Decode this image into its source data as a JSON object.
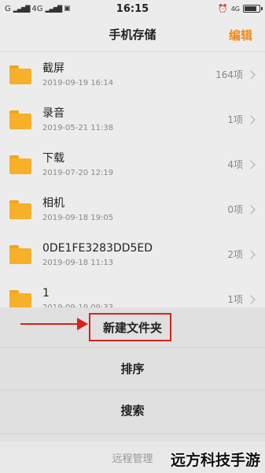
{
  "status_bar": {
    "left_indicators": [
      "G",
      "4G"
    ],
    "time": "16:15",
    "right_network": "4G"
  },
  "header": {
    "title": "手机存储",
    "edit_label": "编辑"
  },
  "files": [
    {
      "name": "截屏",
      "date": "2019-09-19 16:14",
      "count": "164项"
    },
    {
      "name": "录音",
      "date": "2019-05-21 11:38",
      "count": "1项"
    },
    {
      "name": "下载",
      "date": "2019-07-20 12:19",
      "count": "4项"
    },
    {
      "name": "相机",
      "date": "2019-09-18 19:05",
      "count": "0项"
    },
    {
      "name": "0DE1FE3283DD5ED",
      "date": "2019-09-18 11:13",
      "count": "2项"
    },
    {
      "name": "1",
      "date": "2019-09-19 09:33",
      "count": "1项"
    }
  ],
  "actions": {
    "new_folder": "新建文件夹",
    "sort": "排序",
    "search": "搜索",
    "remote": "远程管理"
  },
  "watermark": "远方科技手游",
  "colors": {
    "accent": "#f08a1e",
    "folder": "#f6b02a",
    "highlight": "#d9231d"
  }
}
